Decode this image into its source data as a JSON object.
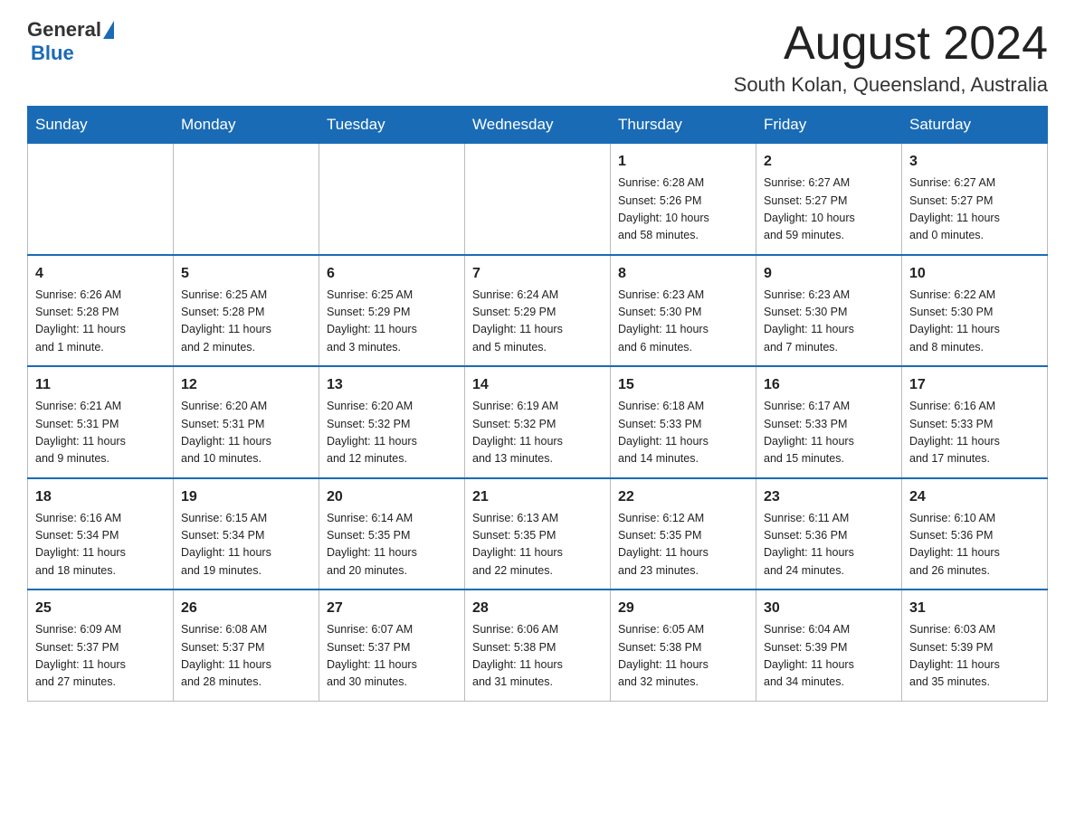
{
  "header": {
    "logo_general": "General",
    "logo_blue": "Blue",
    "title": "August 2024",
    "subtitle": "South Kolan, Queensland, Australia"
  },
  "days_of_week": [
    "Sunday",
    "Monday",
    "Tuesday",
    "Wednesday",
    "Thursday",
    "Friday",
    "Saturday"
  ],
  "weeks": [
    [
      {
        "day": "",
        "info": ""
      },
      {
        "day": "",
        "info": ""
      },
      {
        "day": "",
        "info": ""
      },
      {
        "day": "",
        "info": ""
      },
      {
        "day": "1",
        "info": "Sunrise: 6:28 AM\nSunset: 5:26 PM\nDaylight: 10 hours\nand 58 minutes."
      },
      {
        "day": "2",
        "info": "Sunrise: 6:27 AM\nSunset: 5:27 PM\nDaylight: 10 hours\nand 59 minutes."
      },
      {
        "day": "3",
        "info": "Sunrise: 6:27 AM\nSunset: 5:27 PM\nDaylight: 11 hours\nand 0 minutes."
      }
    ],
    [
      {
        "day": "4",
        "info": "Sunrise: 6:26 AM\nSunset: 5:28 PM\nDaylight: 11 hours\nand 1 minute."
      },
      {
        "day": "5",
        "info": "Sunrise: 6:25 AM\nSunset: 5:28 PM\nDaylight: 11 hours\nand 2 minutes."
      },
      {
        "day": "6",
        "info": "Sunrise: 6:25 AM\nSunset: 5:29 PM\nDaylight: 11 hours\nand 3 minutes."
      },
      {
        "day": "7",
        "info": "Sunrise: 6:24 AM\nSunset: 5:29 PM\nDaylight: 11 hours\nand 5 minutes."
      },
      {
        "day": "8",
        "info": "Sunrise: 6:23 AM\nSunset: 5:30 PM\nDaylight: 11 hours\nand 6 minutes."
      },
      {
        "day": "9",
        "info": "Sunrise: 6:23 AM\nSunset: 5:30 PM\nDaylight: 11 hours\nand 7 minutes."
      },
      {
        "day": "10",
        "info": "Sunrise: 6:22 AM\nSunset: 5:30 PM\nDaylight: 11 hours\nand 8 minutes."
      }
    ],
    [
      {
        "day": "11",
        "info": "Sunrise: 6:21 AM\nSunset: 5:31 PM\nDaylight: 11 hours\nand 9 minutes."
      },
      {
        "day": "12",
        "info": "Sunrise: 6:20 AM\nSunset: 5:31 PM\nDaylight: 11 hours\nand 10 minutes."
      },
      {
        "day": "13",
        "info": "Sunrise: 6:20 AM\nSunset: 5:32 PM\nDaylight: 11 hours\nand 12 minutes."
      },
      {
        "day": "14",
        "info": "Sunrise: 6:19 AM\nSunset: 5:32 PM\nDaylight: 11 hours\nand 13 minutes."
      },
      {
        "day": "15",
        "info": "Sunrise: 6:18 AM\nSunset: 5:33 PM\nDaylight: 11 hours\nand 14 minutes."
      },
      {
        "day": "16",
        "info": "Sunrise: 6:17 AM\nSunset: 5:33 PM\nDaylight: 11 hours\nand 15 minutes."
      },
      {
        "day": "17",
        "info": "Sunrise: 6:16 AM\nSunset: 5:33 PM\nDaylight: 11 hours\nand 17 minutes."
      }
    ],
    [
      {
        "day": "18",
        "info": "Sunrise: 6:16 AM\nSunset: 5:34 PM\nDaylight: 11 hours\nand 18 minutes."
      },
      {
        "day": "19",
        "info": "Sunrise: 6:15 AM\nSunset: 5:34 PM\nDaylight: 11 hours\nand 19 minutes."
      },
      {
        "day": "20",
        "info": "Sunrise: 6:14 AM\nSunset: 5:35 PM\nDaylight: 11 hours\nand 20 minutes."
      },
      {
        "day": "21",
        "info": "Sunrise: 6:13 AM\nSunset: 5:35 PM\nDaylight: 11 hours\nand 22 minutes."
      },
      {
        "day": "22",
        "info": "Sunrise: 6:12 AM\nSunset: 5:35 PM\nDaylight: 11 hours\nand 23 minutes."
      },
      {
        "day": "23",
        "info": "Sunrise: 6:11 AM\nSunset: 5:36 PM\nDaylight: 11 hours\nand 24 minutes."
      },
      {
        "day": "24",
        "info": "Sunrise: 6:10 AM\nSunset: 5:36 PM\nDaylight: 11 hours\nand 26 minutes."
      }
    ],
    [
      {
        "day": "25",
        "info": "Sunrise: 6:09 AM\nSunset: 5:37 PM\nDaylight: 11 hours\nand 27 minutes."
      },
      {
        "day": "26",
        "info": "Sunrise: 6:08 AM\nSunset: 5:37 PM\nDaylight: 11 hours\nand 28 minutes."
      },
      {
        "day": "27",
        "info": "Sunrise: 6:07 AM\nSunset: 5:37 PM\nDaylight: 11 hours\nand 30 minutes."
      },
      {
        "day": "28",
        "info": "Sunrise: 6:06 AM\nSunset: 5:38 PM\nDaylight: 11 hours\nand 31 minutes."
      },
      {
        "day": "29",
        "info": "Sunrise: 6:05 AM\nSunset: 5:38 PM\nDaylight: 11 hours\nand 32 minutes."
      },
      {
        "day": "30",
        "info": "Sunrise: 6:04 AM\nSunset: 5:39 PM\nDaylight: 11 hours\nand 34 minutes."
      },
      {
        "day": "31",
        "info": "Sunrise: 6:03 AM\nSunset: 5:39 PM\nDaylight: 11 hours\nand 35 minutes."
      }
    ]
  ]
}
